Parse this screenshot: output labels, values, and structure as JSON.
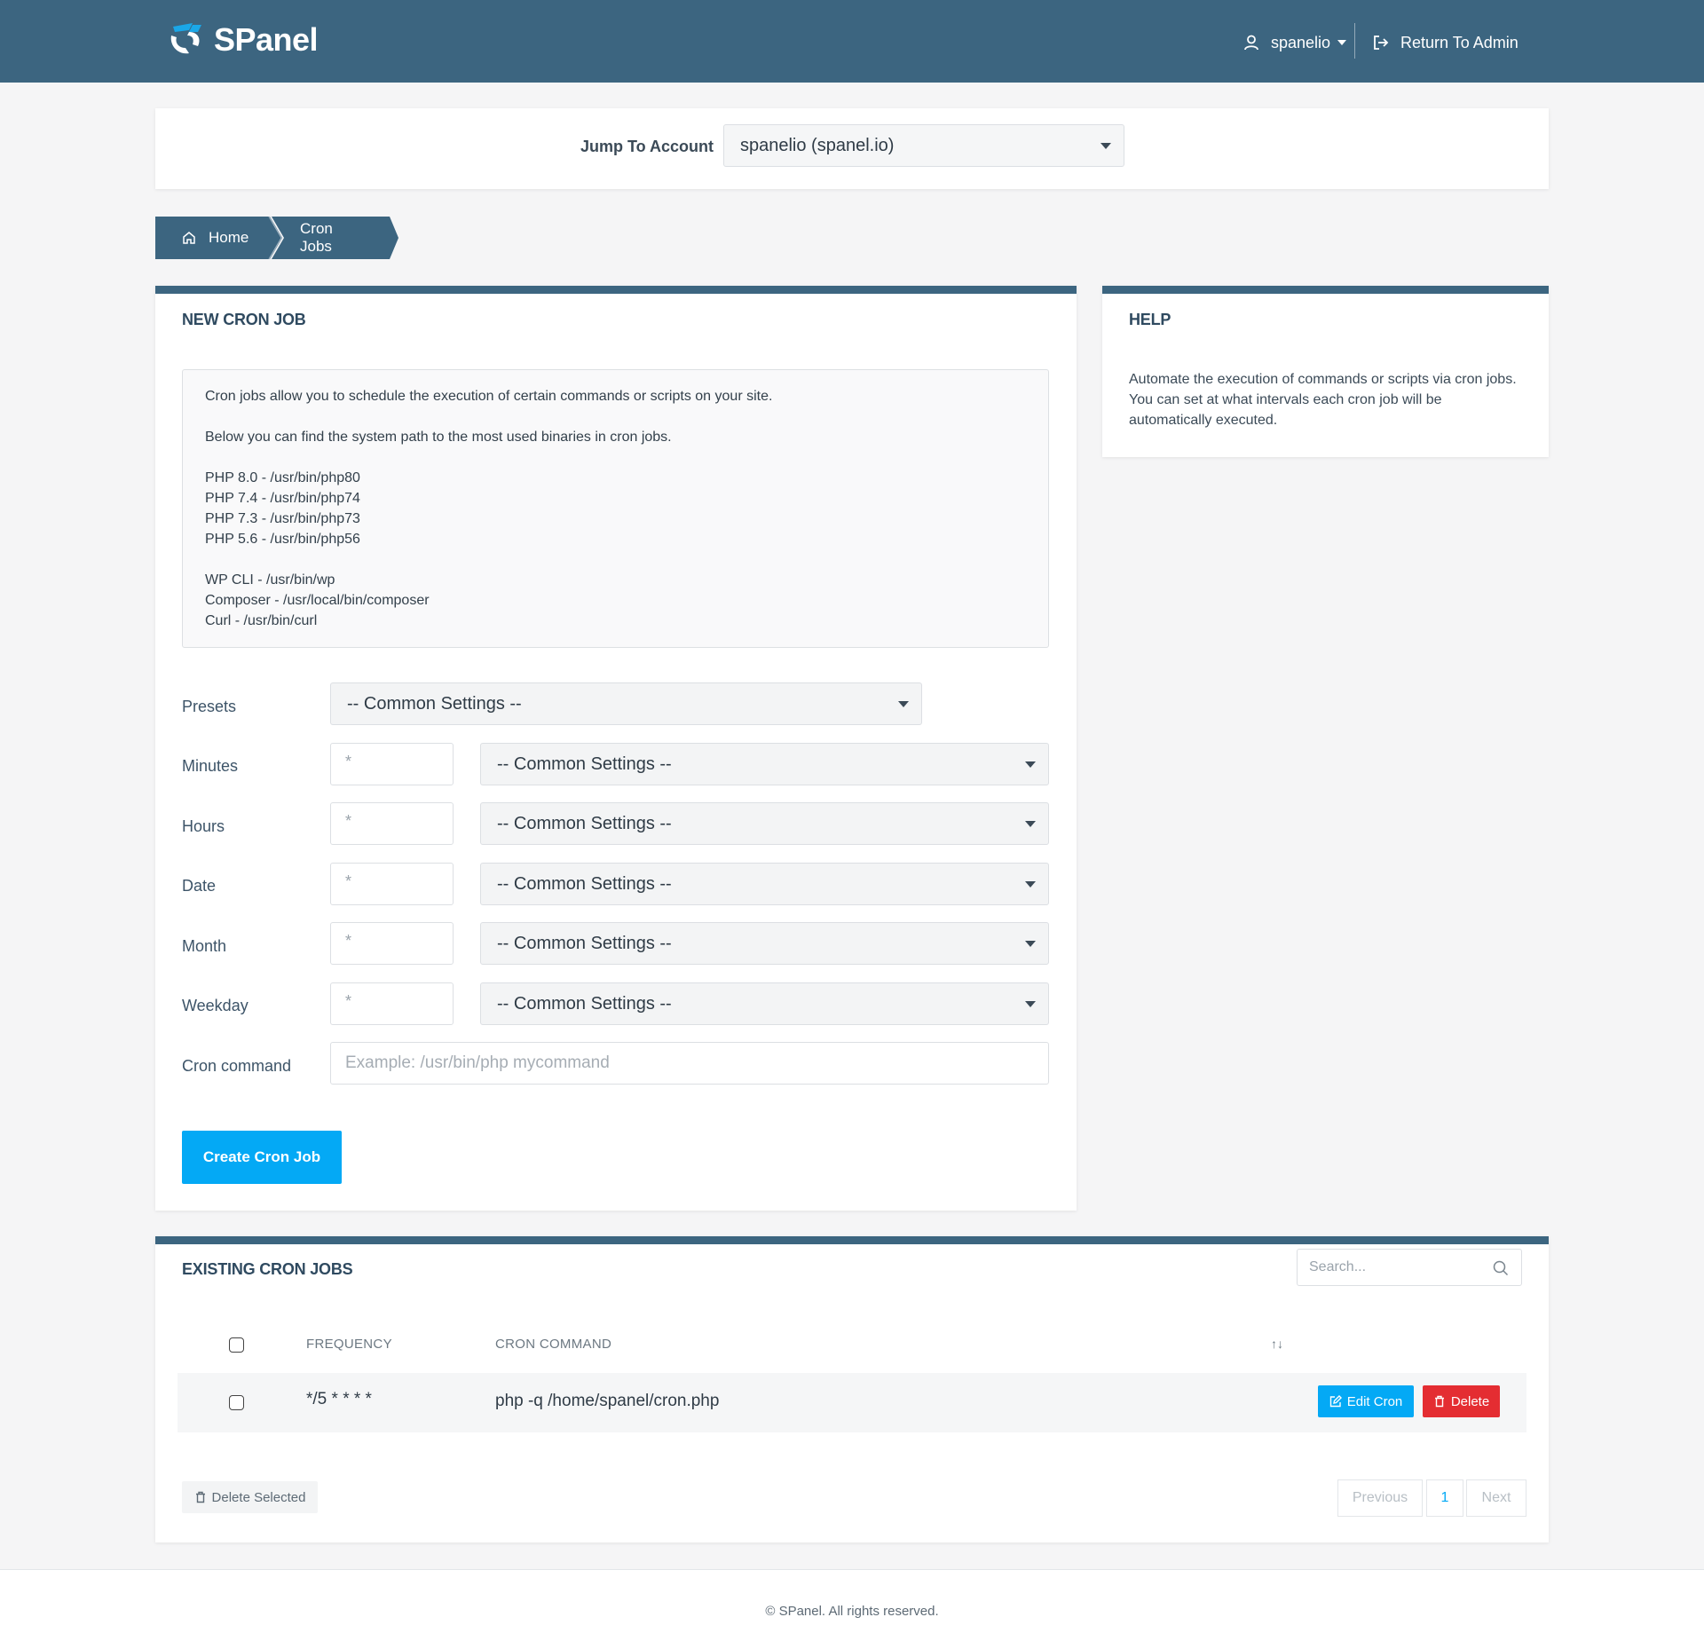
{
  "header": {
    "brand": "SPanel",
    "user": "spanelio",
    "return_admin": "Return To Admin"
  },
  "jump": {
    "label": "Jump To Account",
    "selected": "spanelio (spanel.io)"
  },
  "breadcrumb": {
    "home": "Home",
    "current": "Cron Jobs"
  },
  "new_cron": {
    "title": "NEW CRON JOB",
    "info": {
      "intro": "Cron jobs allow you to schedule the execution of certain commands or scripts on your site.",
      "paths_intro": "Below you can find the system path to the most used binaries in cron jobs.",
      "php80": "PHP 8.0 - /usr/bin/php80",
      "php74": "PHP 7.4 - /usr/bin/php74",
      "php73": "PHP 7.3 - /usr/bin/php73",
      "php56": "PHP 5.6 - /usr/bin/php56",
      "wpcli": "WP CLI - /usr/bin/wp",
      "composer": "Composer - /usr/local/bin/composer",
      "curl": "Curl - /usr/bin/curl"
    },
    "presets_label": "Presets",
    "common_settings": "-- Common Settings --",
    "fields": [
      {
        "label": "Minutes",
        "placeholder": "*"
      },
      {
        "label": "Hours",
        "placeholder": "*"
      },
      {
        "label": "Date",
        "placeholder": "*"
      },
      {
        "label": "Month",
        "placeholder": "*"
      },
      {
        "label": "Weekday",
        "placeholder": "*"
      }
    ],
    "command_label": "Cron command",
    "command_placeholder": "Example: /usr/bin/php mycommand",
    "create_button": "Create Cron Job"
  },
  "help": {
    "title": "HELP",
    "text": "Automate the execution of commands or scripts via cron jobs. You can set at what intervals each cron job will be automatically executed."
  },
  "existing": {
    "title": "EXISTING CRON JOBS",
    "search_placeholder": "Search...",
    "columns": {
      "frequency": "FREQUENCY",
      "command": "CRON COMMAND",
      "sort": "↑↓"
    },
    "rows": [
      {
        "frequency": "*/5 * * * *",
        "command": "php -q /home/spanel/cron.php"
      }
    ],
    "edit_button": "Edit Cron",
    "delete_button": "Delete",
    "delete_selected": "Delete Selected",
    "pagination": {
      "previous": "Previous",
      "page": "1",
      "next": "Next"
    }
  },
  "footer": {
    "text": "© SPanel. All rights reserved."
  },
  "colors": {
    "header_bg": "#3c6580",
    "primary": "#04a9f5",
    "danger": "#e42d32"
  }
}
